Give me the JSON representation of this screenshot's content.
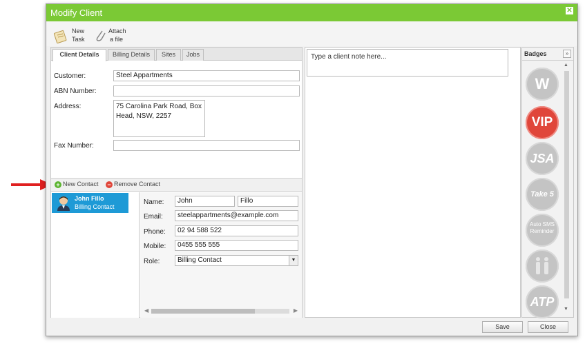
{
  "window": {
    "title": "Modify Client"
  },
  "toolbar": {
    "new_task_line1": "New",
    "new_task_line2": "Task",
    "attach_line1": "Attach",
    "attach_line2": "a file"
  },
  "tabs": [
    "Client Details",
    "Billing Details",
    "Sites",
    "Jobs"
  ],
  "client": {
    "customer_label": "Customer:",
    "customer_value": "Steel Appartments",
    "abn_label": "ABN Number:",
    "abn_value": "",
    "address_label": "Address:",
    "address_line1": "75 Carolina Park Road, Box",
    "address_line2": "Head, NSW, 2257",
    "fax_label": "Fax Number:",
    "fax_value": ""
  },
  "contact_actions": {
    "new": "New Contact",
    "remove": "Remove Contact"
  },
  "contacts": [
    {
      "name": "John Fillo",
      "role": "Billing Contact"
    }
  ],
  "contact_detail": {
    "name_label": "Name:",
    "first_name": "John",
    "last_name": "Fillo",
    "email_label": "Email:",
    "email": "steelappartments@example.com",
    "phone_label": "Phone:",
    "phone": "02 94 588 522",
    "mobile_label": "Mobile:",
    "mobile": "0455 555 555",
    "role_label": "Role:",
    "role": "Billing Contact"
  },
  "notes": {
    "placeholder": "Type a client note here..."
  },
  "badges": {
    "title": "Badges",
    "items": [
      "W",
      "VIP",
      "JSA",
      "Take 5",
      "Auto SMS Reminder",
      "",
      "ATP"
    ],
    "colors": {
      "inactive": "#c4c4c4",
      "vip": "#e0463a"
    }
  },
  "footer": {
    "save": "Save",
    "close": "Close"
  },
  "colors": {
    "titlebar": "#7bc935",
    "selection": "#1e9ad6",
    "arrow": "#e02020"
  }
}
